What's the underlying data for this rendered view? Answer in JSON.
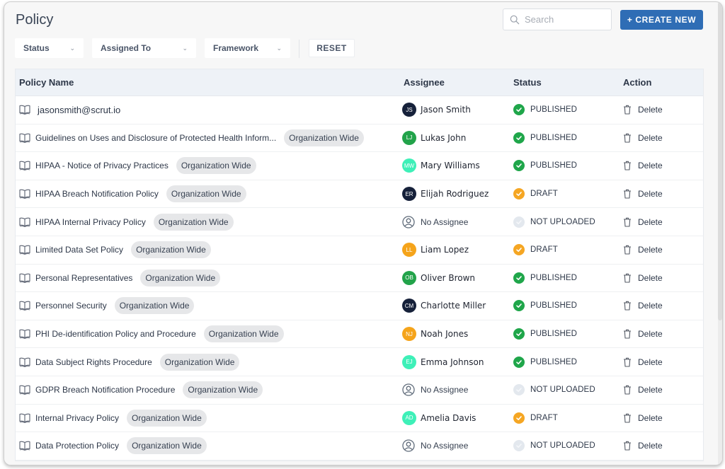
{
  "header": {
    "title": "Policy",
    "search_placeholder": "Search",
    "create_label": "+ CREATE NEW"
  },
  "filters": {
    "status_label": "Status",
    "assigned_label": "Assigned To",
    "framework_label": "Framework",
    "reset_label": "RESET"
  },
  "colors": {
    "primary": "#2f6db5",
    "published": "#1fa64a",
    "draft": "#f5a623",
    "not_uploaded": "#e3e8ee"
  },
  "table": {
    "columns": {
      "name": "Policy Name",
      "assignee": "Assignee",
      "status": "Status",
      "action": "Action"
    },
    "rows": [
      {
        "name": "jasonsmith@scrut.io",
        "tag": "",
        "assignee": "Jason Smith",
        "initials": "JS",
        "avatar_color": "#16213a",
        "status": "PUBLISHED",
        "status_kind": "published",
        "action": "Delete"
      },
      {
        "name": "Guidelines on Uses and Disclosure of Protected Health Inform...",
        "tag": "Organization Wide",
        "assignee": "Lukas John",
        "initials": "LJ",
        "avatar_color": "#22a34a",
        "status": "PUBLISHED",
        "status_kind": "published",
        "action": "Delete"
      },
      {
        "name": "HIPAA - Notice of Privacy Practices",
        "tag": "Organization Wide",
        "assignee": "Mary Williams",
        "initials": "MW",
        "avatar_color": "#3ef0b8",
        "status": "PUBLISHED",
        "status_kind": "published",
        "action": "Delete"
      },
      {
        "name": "HIPAA Breach Notification Policy",
        "tag": "Organization Wide",
        "assignee": "Elijah Rodriguez",
        "initials": "ER",
        "avatar_color": "#16213a",
        "status": "DRAFT",
        "status_kind": "draft",
        "action": "Delete"
      },
      {
        "name": "HIPAA Internal Privacy Policy",
        "tag": "Organization Wide",
        "assignee": "No Assignee",
        "initials": "",
        "avatar_color": "",
        "status": "NOT UPLOADED",
        "status_kind": "not_uploaded",
        "action": "Delete"
      },
      {
        "name": "Limited Data Set Policy",
        "tag": "Organization Wide",
        "assignee": "Liam Lopez",
        "initials": "LL",
        "avatar_color": "#f5a41b",
        "status": "DRAFT",
        "status_kind": "draft",
        "action": "Delete"
      },
      {
        "name": "Personal Representatives",
        "tag": "Organization Wide",
        "assignee": "Oliver Brown",
        "initials": "OB",
        "avatar_color": "#22a34a",
        "status": "PUBLISHED",
        "status_kind": "published",
        "action": "Delete"
      },
      {
        "name": "Personnel Security",
        "tag": "Organization Wide",
        "assignee": "Charlotte Miller",
        "initials": "CM",
        "avatar_color": "#16213a",
        "status": "PUBLISHED",
        "status_kind": "published",
        "action": "Delete"
      },
      {
        "name": "PHI De-identification Policy and Procedure",
        "tag": "Organization Wide",
        "assignee": "Noah Jones",
        "initials": "NJ",
        "avatar_color": "#f5a41b",
        "status": "PUBLISHED",
        "status_kind": "published",
        "action": "Delete"
      },
      {
        "name": "Data Subject Rights Procedure",
        "tag": "Organization Wide",
        "assignee": "Emma Johnson",
        "initials": "EJ",
        "avatar_color": "#3ef0b8",
        "status": "PUBLISHED",
        "status_kind": "published",
        "action": "Delete"
      },
      {
        "name": "GDPR Breach Notification Procedure",
        "tag": "Organization Wide",
        "assignee": "No Assignee",
        "initials": "",
        "avatar_color": "",
        "status": "NOT UPLOADED",
        "status_kind": "not_uploaded",
        "action": "Delete"
      },
      {
        "name": "Internal Privacy Policy",
        "tag": "Organization Wide",
        "assignee": "Amelia Davis",
        "initials": "AD",
        "avatar_color": "#3ef0b8",
        "status": "DRAFT",
        "status_kind": "draft",
        "action": "Delete"
      },
      {
        "name": "Data Protection Policy",
        "tag": "Organization Wide",
        "assignee": "No Assignee",
        "initials": "",
        "avatar_color": "",
        "status": "NOT UPLOADED",
        "status_kind": "not_uploaded",
        "action": "Delete"
      }
    ]
  }
}
